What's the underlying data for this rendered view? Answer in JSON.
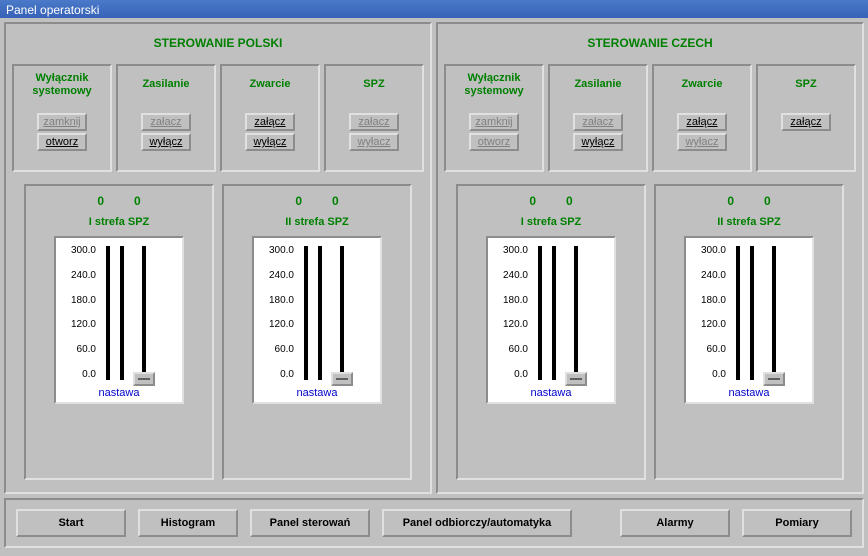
{
  "window_title": "Panel operatorski",
  "panels": [
    {
      "title": "STEROWANIE POLSKI",
      "groups": [
        {
          "title": "Wyłącznik systemowy",
          "btns": [
            {
              "label": "zamknij",
              "state": "disabled"
            },
            {
              "label": "otworz",
              "state": "under"
            }
          ]
        },
        {
          "title": "Zasilanie",
          "btns": [
            {
              "label": "załacz",
              "state": "disabled"
            },
            {
              "label": "wyłącz",
              "state": "under"
            }
          ]
        },
        {
          "title": "Zwarcie",
          "btns": [
            {
              "label": "załącz",
              "state": "under"
            },
            {
              "label": "wyłącz",
              "state": "under"
            }
          ]
        },
        {
          "title": "SPZ",
          "btns": [
            {
              "label": "załacz",
              "state": "disabled"
            },
            {
              "label": "wyłacz",
              "state": "disabled"
            }
          ]
        }
      ],
      "zones": [
        {
          "v1": "0",
          "v2": "0",
          "title": "I strefa SPZ",
          "scale": [
            "300.0",
            "240.0",
            "180.0",
            "120.0",
            "60.0",
            "0.0"
          ],
          "label": "nastawa"
        },
        {
          "v1": "0",
          "v2": "0",
          "title": "II strefa SPZ",
          "scale": [
            "300.0",
            "240.0",
            "180.0",
            "120.0",
            "60.0",
            "0.0"
          ],
          "label": "nastawa"
        }
      ]
    },
    {
      "title": "STEROWANIE CZECH",
      "groups": [
        {
          "title": "Wyłącznik systemowy",
          "btns": [
            {
              "label": "zamknij",
              "state": "disabled"
            },
            {
              "label": "otworz",
              "state": "disabled"
            }
          ]
        },
        {
          "title": "Zasilanie",
          "btns": [
            {
              "label": "załacz",
              "state": "disabled"
            },
            {
              "label": "wyłącz",
              "state": "under"
            }
          ]
        },
        {
          "title": "Zwarcie",
          "btns": [
            {
              "label": "załącz",
              "state": "under"
            },
            {
              "label": "wyłacz",
              "state": "disabled"
            }
          ]
        },
        {
          "title": "SPZ",
          "btns": [
            {
              "label": "załącz",
              "state": "under"
            }
          ]
        }
      ],
      "zones": [
        {
          "v1": "0",
          "v2": "0",
          "title": "I strefa SPZ",
          "scale": [
            "300.0",
            "240.0",
            "180.0",
            "120.0",
            "60.0",
            "0.0"
          ],
          "label": "nastawa"
        },
        {
          "v1": "0",
          "v2": "0",
          "title": "II strefa SPZ",
          "scale": [
            "300.0",
            "240.0",
            "180.0",
            "120.0",
            "60.0",
            "0.0"
          ],
          "label": "nastawa"
        }
      ]
    }
  ],
  "bottom": {
    "start": "Start",
    "histogram": "Histogram",
    "panel_sterowan": "Panel sterowań",
    "panel_odbiorczy": "Panel odbiorczy/automatyka",
    "alarmy": "Alarmy",
    "pomiary": "Pomiary"
  }
}
